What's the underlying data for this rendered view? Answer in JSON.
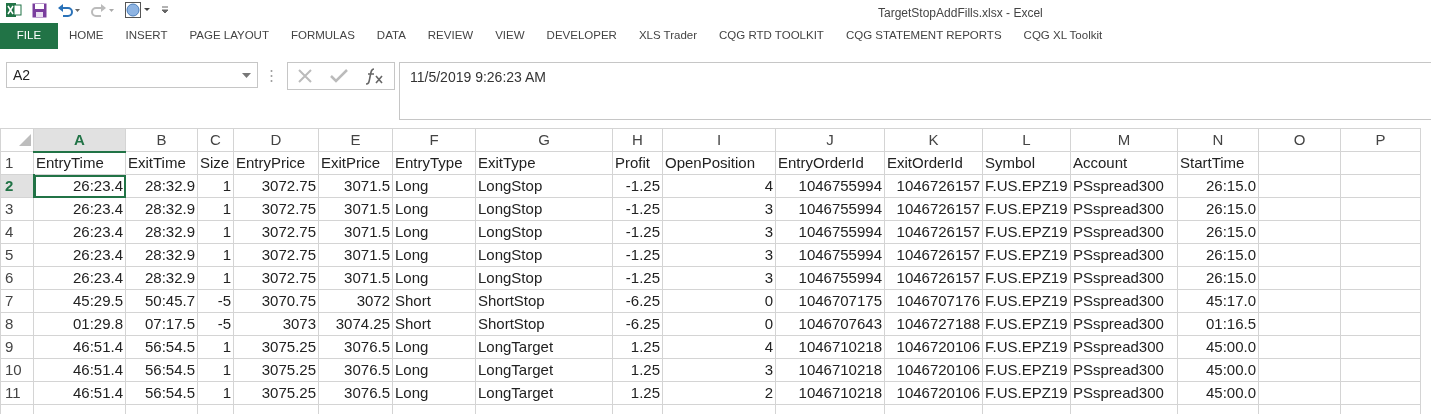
{
  "window": {
    "title": "TargetStopAddFills.xlsx - Excel"
  },
  "ribbon_tabs": [
    {
      "label": "FILE",
      "kind": "file",
      "selected": false
    },
    {
      "label": "HOME",
      "kind": "tab",
      "selected": false
    },
    {
      "label": "INSERT",
      "kind": "tab",
      "selected": false
    },
    {
      "label": "PAGE LAYOUT",
      "kind": "tab",
      "selected": false
    },
    {
      "label": "FORMULAS",
      "kind": "tab",
      "selected": false
    },
    {
      "label": "DATA",
      "kind": "tab",
      "selected": false
    },
    {
      "label": "REVIEW",
      "kind": "tab",
      "selected": false
    },
    {
      "label": "VIEW",
      "kind": "tab",
      "selected": false
    },
    {
      "label": "DEVELOPER",
      "kind": "tab",
      "selected": false
    },
    {
      "label": "XLS Trader",
      "kind": "tab",
      "selected": false
    },
    {
      "label": "CQG RTD TOOLKIT",
      "kind": "tab",
      "selected": false
    },
    {
      "label": "CQG STATEMENT REPORTS",
      "kind": "tab",
      "selected": false
    },
    {
      "label": "CQG XL Toolkit",
      "kind": "tab",
      "selected": false
    }
  ],
  "name_box": "A2",
  "formula_bar": "11/5/2019  9:26:23 AM",
  "columns": [
    {
      "letter": "A",
      "selected": true,
      "kind": "number"
    },
    {
      "letter": "B",
      "selected": false,
      "kind": "number"
    },
    {
      "letter": "C",
      "selected": false,
      "kind": "number"
    },
    {
      "letter": "D",
      "selected": false,
      "kind": "number"
    },
    {
      "letter": "E",
      "selected": false,
      "kind": "number"
    },
    {
      "letter": "F",
      "selected": false,
      "kind": "text"
    },
    {
      "letter": "G",
      "selected": false,
      "kind": "text"
    },
    {
      "letter": "H",
      "selected": false,
      "kind": "number"
    },
    {
      "letter": "I",
      "selected": false,
      "kind": "number"
    },
    {
      "letter": "J",
      "selected": false,
      "kind": "number"
    },
    {
      "letter": "K",
      "selected": false,
      "kind": "number"
    },
    {
      "letter": "L",
      "selected": false,
      "kind": "text"
    },
    {
      "letter": "M",
      "selected": false,
      "kind": "text"
    },
    {
      "letter": "N",
      "selected": false,
      "kind": "number"
    },
    {
      "letter": "O",
      "selected": false,
      "kind": "number"
    },
    {
      "letter": "P",
      "selected": false,
      "kind": "number"
    }
  ],
  "rows": [
    {
      "number": "1",
      "selected": false,
      "kind": "header",
      "cells": [
        "EntryTime",
        "ExitTime",
        "Size",
        "EntryPrice",
        "ExitPrice",
        "EntryType",
        "ExitType",
        "Profit",
        "OpenPosition",
        "EntryOrderId",
        "ExitOrderId",
        "Symbol",
        "Account",
        "StartTime"
      ]
    },
    {
      "number": "2",
      "selected": true,
      "kind": "data",
      "cells": [
        "26:23.4",
        "28:32.9",
        "1",
        "3072.75",
        "3071.5",
        "Long",
        "LongStop",
        "-1.25",
        "4",
        "1046755994",
        "1046726157",
        "F.US.EPZ19",
        "PSspread300",
        "26:15.0"
      ]
    },
    {
      "number": "3",
      "selected": false,
      "kind": "data",
      "cells": [
        "26:23.4",
        "28:32.9",
        "1",
        "3072.75",
        "3071.5",
        "Long",
        "LongStop",
        "-1.25",
        "3",
        "1046755994",
        "1046726157",
        "F.US.EPZ19",
        "PSspread300",
        "26:15.0"
      ]
    },
    {
      "number": "4",
      "selected": false,
      "kind": "data",
      "cells": [
        "26:23.4",
        "28:32.9",
        "1",
        "3072.75",
        "3071.5",
        "Long",
        "LongStop",
        "-1.25",
        "3",
        "1046755994",
        "1046726157",
        "F.US.EPZ19",
        "PSspread300",
        "26:15.0"
      ]
    },
    {
      "number": "5",
      "selected": false,
      "kind": "data",
      "cells": [
        "26:23.4",
        "28:32.9",
        "1",
        "3072.75",
        "3071.5",
        "Long",
        "LongStop",
        "-1.25",
        "3",
        "1046755994",
        "1046726157",
        "F.US.EPZ19",
        "PSspread300",
        "26:15.0"
      ]
    },
    {
      "number": "6",
      "selected": false,
      "kind": "data",
      "cells": [
        "26:23.4",
        "28:32.9",
        "1",
        "3072.75",
        "3071.5",
        "Long",
        "LongStop",
        "-1.25",
        "3",
        "1046755994",
        "1046726157",
        "F.US.EPZ19",
        "PSspread300",
        "26:15.0"
      ]
    },
    {
      "number": "7",
      "selected": false,
      "kind": "data",
      "cells": [
        "45:29.5",
        "50:45.7",
        "-5",
        "3070.75",
        "3072",
        "Short",
        "ShortStop",
        "-6.25",
        "0",
        "1046707175",
        "1046707176",
        "F.US.EPZ19",
        "PSspread300",
        "45:17.0"
      ]
    },
    {
      "number": "8",
      "selected": false,
      "kind": "data",
      "cells": [
        "01:29.8",
        "07:17.5",
        "-5",
        "3073",
        "3074.25",
        "Short",
        "ShortStop",
        "-6.25",
        "0",
        "1046707643",
        "1046727188",
        "F.US.EPZ19",
        "PSspread300",
        "01:16.5"
      ]
    },
    {
      "number": "9",
      "selected": false,
      "kind": "data",
      "cells": [
        "46:51.4",
        "56:54.5",
        "1",
        "3075.25",
        "3076.5",
        "Long",
        "LongTarget",
        "1.25",
        "4",
        "1046710218",
        "1046720106",
        "F.US.EPZ19",
        "PSspread300",
        "45:00.0"
      ]
    },
    {
      "number": "10",
      "selected": false,
      "kind": "data",
      "cells": [
        "46:51.4",
        "56:54.5",
        "1",
        "3075.25",
        "3076.5",
        "Long",
        "LongTarget",
        "1.25",
        "3",
        "1046710218",
        "1046720106",
        "F.US.EPZ19",
        "PSspread300",
        "45:00.0"
      ]
    },
    {
      "number": "11",
      "selected": false,
      "kind": "data",
      "cells": [
        "46:51.4",
        "56:54.5",
        "1",
        "3075.25",
        "3076.5",
        "Long",
        "LongTarget",
        "1.25",
        "2",
        "1046710218",
        "1046720106",
        "F.US.EPZ19",
        "PSspread300",
        "45:00.0"
      ]
    }
  ]
}
